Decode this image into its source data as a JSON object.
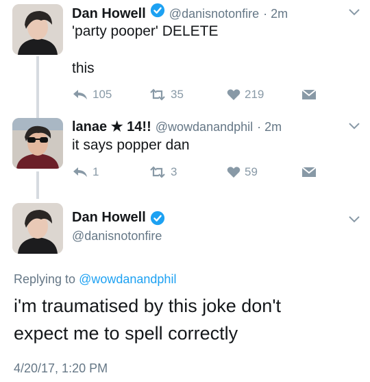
{
  "tweets": [
    {
      "name": "Dan Howell",
      "handle": "@danisnotonfire",
      "time": "· 2m",
      "line1": "'party pooper' DELETE",
      "line2": "this",
      "replies": "105",
      "retweets": "35",
      "likes": "219"
    },
    {
      "name": "lanae ★ 14!!",
      "handle": "@wowdanandphil",
      "time": "· 2m",
      "line1": "it says popper dan",
      "replies": "1",
      "retweets": "3",
      "likes": "59"
    }
  ],
  "main": {
    "name": "Dan Howell",
    "handle": "@danisnotonfire",
    "replying_prefix": "Replying to",
    "replying_to": "@wowdanandphil",
    "text_line1": "i'm traumatised by this joke don't",
    "text_line2": "expect me to spell correctly",
    "timestamp": "4/20/17, 1:20 PM"
  },
  "colors": {
    "verified": "#1da1f2",
    "link": "#1da1f2",
    "icon_gray": "#8899a6",
    "thread_line": "#d6dbe0"
  },
  "icons": [
    "chevron-down-icon",
    "reply-icon",
    "retweet-icon",
    "heart-icon",
    "dm-envelope-icon",
    "verified-badge-icon"
  ]
}
